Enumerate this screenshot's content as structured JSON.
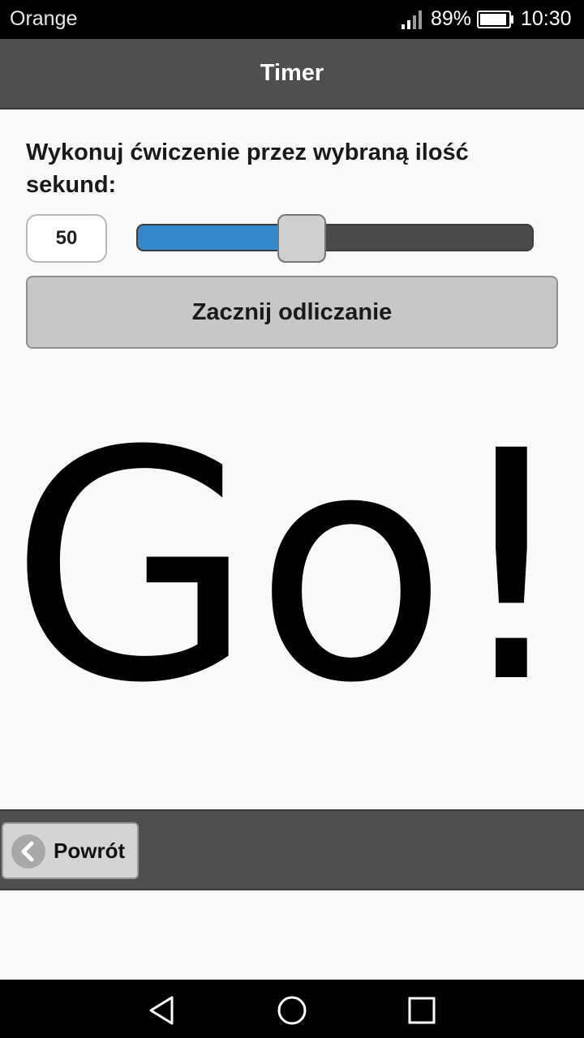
{
  "status_bar": {
    "carrier": "Orange",
    "battery_percent": "89%",
    "time": "10:30",
    "icons": [
      "signal-icon",
      "battery-icon"
    ]
  },
  "header": {
    "title": "Timer"
  },
  "main": {
    "prompt": "Wykonuj ćwiczenie przez wybraną ilość sekund:",
    "seconds_input": {
      "value": "50"
    },
    "slider": {
      "value": 50,
      "min": 0,
      "max": 120,
      "fill_color": "#3388cc"
    },
    "start_button_label": "Zacznij odliczanie",
    "countdown_text": "Go!"
  },
  "footer": {
    "back_button_label": "Powrót",
    "back_icon": "chevron-left-icon"
  },
  "nav_bar": {
    "icons": [
      "nav-back-icon",
      "nav-home-icon",
      "nav-recent-icon"
    ]
  }
}
